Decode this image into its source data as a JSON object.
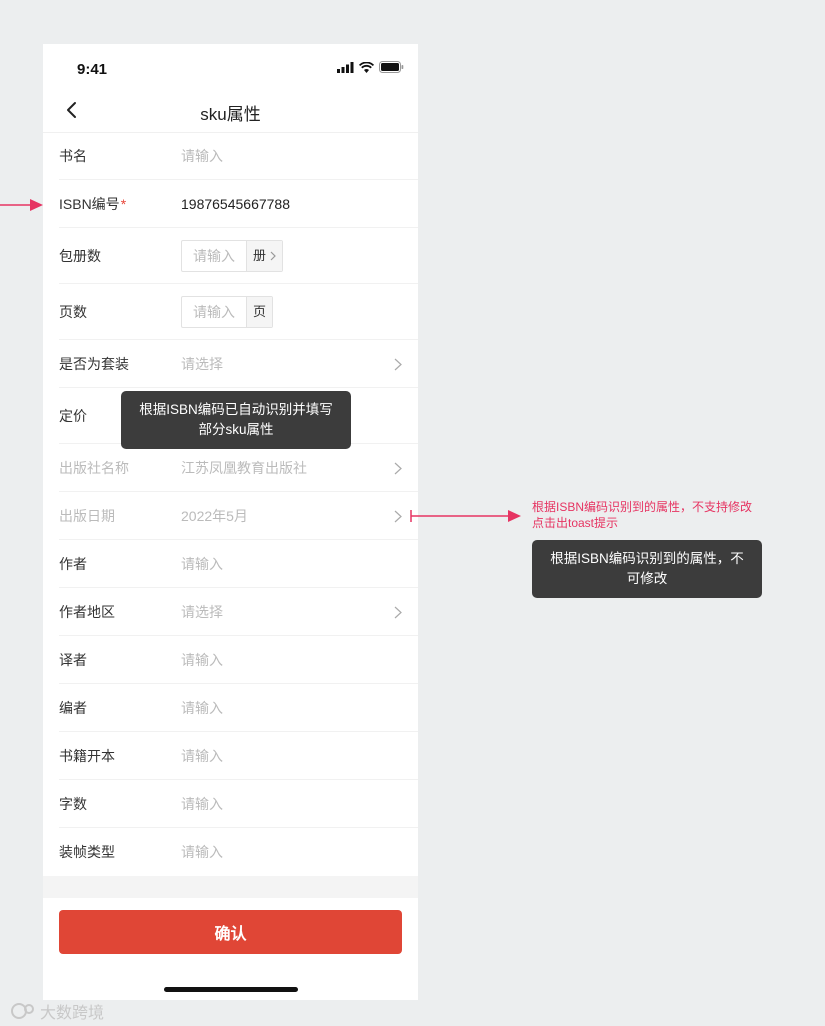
{
  "status_bar": {
    "time": "9:41"
  },
  "nav": {
    "title": "sku属性"
  },
  "fields": [
    {
      "label": "书名",
      "value": "请输入"
    },
    {
      "label": "ISBN编号",
      "required_mark": "*",
      "value": "19876545667788"
    },
    {
      "label": "包册数",
      "placeholder": "请输入",
      "unit": "册"
    },
    {
      "label": "页数",
      "placeholder": "请输入",
      "unit": "页"
    },
    {
      "label": "是否为套装",
      "value": "请选择"
    },
    {
      "label": "定价",
      "value": ""
    },
    {
      "label": "出版社名称",
      "value": "江苏凤凰教育出版社"
    },
    {
      "label": "出版日期",
      "value": "2022年5月"
    },
    {
      "label": "作者",
      "value": "请输入"
    },
    {
      "label": "作者地区",
      "value": "请选择"
    },
    {
      "label": "译者",
      "value": "请输入"
    },
    {
      "label": "编者",
      "value": "请输入"
    },
    {
      "label": "书籍开本",
      "value": "请输入"
    },
    {
      "label": "字数",
      "value": "请输入"
    },
    {
      "label": "装帧类型",
      "value": "请输入"
    }
  ],
  "tooltip_autofill": {
    "line1": "根据ISBN编码已自动识别并填写",
    "line2": "部分sku属性"
  },
  "annotation": {
    "line1": "根据ISBN编码识别到的属性，不支持修改",
    "line2": "点击出toast提示"
  },
  "toast": {
    "line1": "根据ISBN编码识别到的属性，不",
    "line2": "可修改"
  },
  "confirm_label": "确认",
  "watermark": "大数跨境",
  "colors": {
    "accent": "#e04636",
    "annotation": "#e63462",
    "tooltip_bg": "#3c3c3c"
  }
}
